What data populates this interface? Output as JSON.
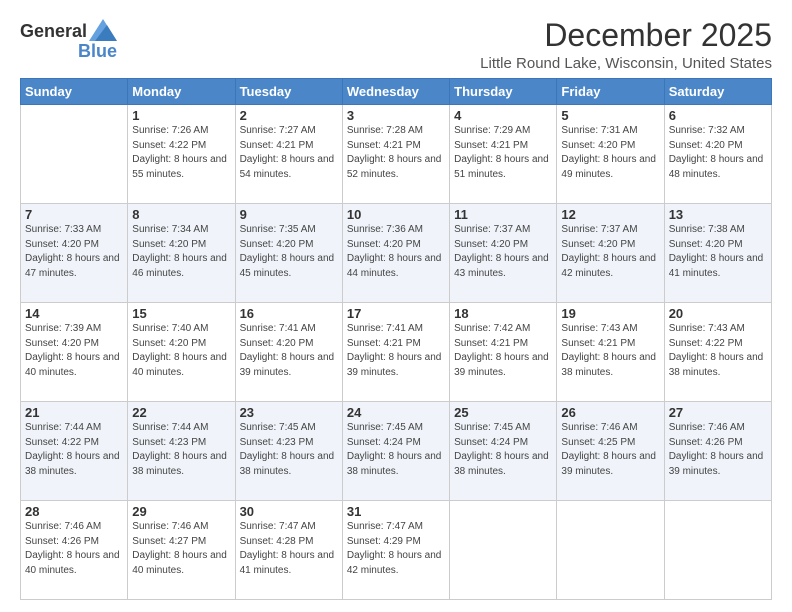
{
  "header": {
    "logo_line1": "General",
    "logo_line2": "Blue",
    "title": "December 2025",
    "subtitle": "Little Round Lake, Wisconsin, United States"
  },
  "days_of_week": [
    "Sunday",
    "Monday",
    "Tuesday",
    "Wednesday",
    "Thursday",
    "Friday",
    "Saturday"
  ],
  "weeks": [
    [
      {
        "day": "",
        "sunrise": "",
        "sunset": "",
        "daylight": ""
      },
      {
        "day": "1",
        "sunrise": "7:26 AM",
        "sunset": "4:22 PM",
        "daylight": "8 hours and 55 minutes."
      },
      {
        "day": "2",
        "sunrise": "7:27 AM",
        "sunset": "4:21 PM",
        "daylight": "8 hours and 54 minutes."
      },
      {
        "day": "3",
        "sunrise": "7:28 AM",
        "sunset": "4:21 PM",
        "daylight": "8 hours and 52 minutes."
      },
      {
        "day": "4",
        "sunrise": "7:29 AM",
        "sunset": "4:21 PM",
        "daylight": "8 hours and 51 minutes."
      },
      {
        "day": "5",
        "sunrise": "7:31 AM",
        "sunset": "4:20 PM",
        "daylight": "8 hours and 49 minutes."
      },
      {
        "day": "6",
        "sunrise": "7:32 AM",
        "sunset": "4:20 PM",
        "daylight": "8 hours and 48 minutes."
      }
    ],
    [
      {
        "day": "7",
        "sunrise": "7:33 AM",
        "sunset": "4:20 PM",
        "daylight": "8 hours and 47 minutes."
      },
      {
        "day": "8",
        "sunrise": "7:34 AM",
        "sunset": "4:20 PM",
        "daylight": "8 hours and 46 minutes."
      },
      {
        "day": "9",
        "sunrise": "7:35 AM",
        "sunset": "4:20 PM",
        "daylight": "8 hours and 45 minutes."
      },
      {
        "day": "10",
        "sunrise": "7:36 AM",
        "sunset": "4:20 PM",
        "daylight": "8 hours and 44 minutes."
      },
      {
        "day": "11",
        "sunrise": "7:37 AM",
        "sunset": "4:20 PM",
        "daylight": "8 hours and 43 minutes."
      },
      {
        "day": "12",
        "sunrise": "7:37 AM",
        "sunset": "4:20 PM",
        "daylight": "8 hours and 42 minutes."
      },
      {
        "day": "13",
        "sunrise": "7:38 AM",
        "sunset": "4:20 PM",
        "daylight": "8 hours and 41 minutes."
      }
    ],
    [
      {
        "day": "14",
        "sunrise": "7:39 AM",
        "sunset": "4:20 PM",
        "daylight": "8 hours and 40 minutes."
      },
      {
        "day": "15",
        "sunrise": "7:40 AM",
        "sunset": "4:20 PM",
        "daylight": "8 hours and 40 minutes."
      },
      {
        "day": "16",
        "sunrise": "7:41 AM",
        "sunset": "4:20 PM",
        "daylight": "8 hours and 39 minutes."
      },
      {
        "day": "17",
        "sunrise": "7:41 AM",
        "sunset": "4:21 PM",
        "daylight": "8 hours and 39 minutes."
      },
      {
        "day": "18",
        "sunrise": "7:42 AM",
        "sunset": "4:21 PM",
        "daylight": "8 hours and 39 minutes."
      },
      {
        "day": "19",
        "sunrise": "7:43 AM",
        "sunset": "4:21 PM",
        "daylight": "8 hours and 38 minutes."
      },
      {
        "day": "20",
        "sunrise": "7:43 AM",
        "sunset": "4:22 PM",
        "daylight": "8 hours and 38 minutes."
      }
    ],
    [
      {
        "day": "21",
        "sunrise": "7:44 AM",
        "sunset": "4:22 PM",
        "daylight": "8 hours and 38 minutes."
      },
      {
        "day": "22",
        "sunrise": "7:44 AM",
        "sunset": "4:23 PM",
        "daylight": "8 hours and 38 minutes."
      },
      {
        "day": "23",
        "sunrise": "7:45 AM",
        "sunset": "4:23 PM",
        "daylight": "8 hours and 38 minutes."
      },
      {
        "day": "24",
        "sunrise": "7:45 AM",
        "sunset": "4:24 PM",
        "daylight": "8 hours and 38 minutes."
      },
      {
        "day": "25",
        "sunrise": "7:45 AM",
        "sunset": "4:24 PM",
        "daylight": "8 hours and 38 minutes."
      },
      {
        "day": "26",
        "sunrise": "7:46 AM",
        "sunset": "4:25 PM",
        "daylight": "8 hours and 39 minutes."
      },
      {
        "day": "27",
        "sunrise": "7:46 AM",
        "sunset": "4:26 PM",
        "daylight": "8 hours and 39 minutes."
      }
    ],
    [
      {
        "day": "28",
        "sunrise": "7:46 AM",
        "sunset": "4:26 PM",
        "daylight": "8 hours and 40 minutes."
      },
      {
        "day": "29",
        "sunrise": "7:46 AM",
        "sunset": "4:27 PM",
        "daylight": "8 hours and 40 minutes."
      },
      {
        "day": "30",
        "sunrise": "7:47 AM",
        "sunset": "4:28 PM",
        "daylight": "8 hours and 41 minutes."
      },
      {
        "day": "31",
        "sunrise": "7:47 AM",
        "sunset": "4:29 PM",
        "daylight": "8 hours and 42 minutes."
      },
      {
        "day": "",
        "sunrise": "",
        "sunset": "",
        "daylight": ""
      },
      {
        "day": "",
        "sunrise": "",
        "sunset": "",
        "daylight": ""
      },
      {
        "day": "",
        "sunrise": "",
        "sunset": "",
        "daylight": ""
      }
    ]
  ],
  "labels": {
    "sunrise": "Sunrise:",
    "sunset": "Sunset:",
    "daylight": "Daylight:"
  }
}
